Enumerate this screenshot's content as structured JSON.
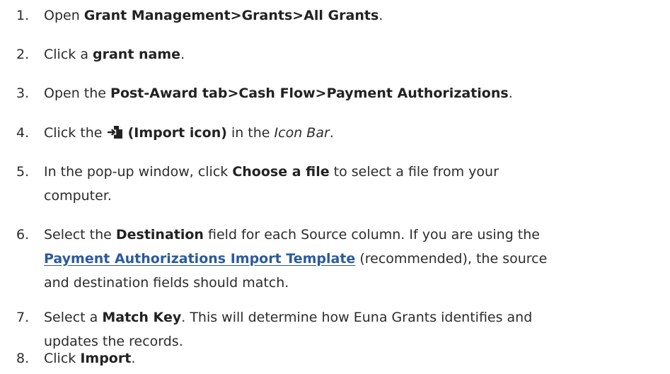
{
  "steps": [
    {
      "number": "1.",
      "parts": [
        "Open ",
        "Grant Management>Grants>All Grants",
        "."
      ]
    },
    {
      "number": "2.",
      "parts": [
        "Click a ",
        "grant name",
        "."
      ]
    },
    {
      "number": "3.",
      "parts": [
        "Open the ",
        "Post-Award tab>Cash Flow>Payment Authorizations",
        "."
      ]
    },
    {
      "number": "4.",
      "parts": [
        "Click the ",
        "(Import icon)",
        " in the ",
        "Icon Bar",
        "."
      ]
    },
    {
      "number": "5.",
      "line1": [
        "In the pop-up window, click ",
        "Choose a file",
        " to select a file from your"
      ],
      "line2": "computer."
    },
    {
      "number": "6.",
      "line1": [
        "Select the ",
        "Destination",
        " field for each Source column. If you are using the"
      ],
      "line2": [
        "Payment Authorizations Import Template",
        " (recommended), the source"
      ],
      "line3": "and destination fields should match."
    },
    {
      "number": "7.",
      "line1": [
        "Select a ",
        "Match Key",
        ". This will determine how Euna Grants identifies and"
      ],
      "line2": "updates the records."
    },
    {
      "number": "8.",
      "parts": [
        "Click ",
        "Import",
        "."
      ]
    }
  ],
  "icons": {
    "import": "import-icon"
  },
  "colors": {
    "text": "#2b2b2b",
    "link": "#2a5a9e"
  }
}
